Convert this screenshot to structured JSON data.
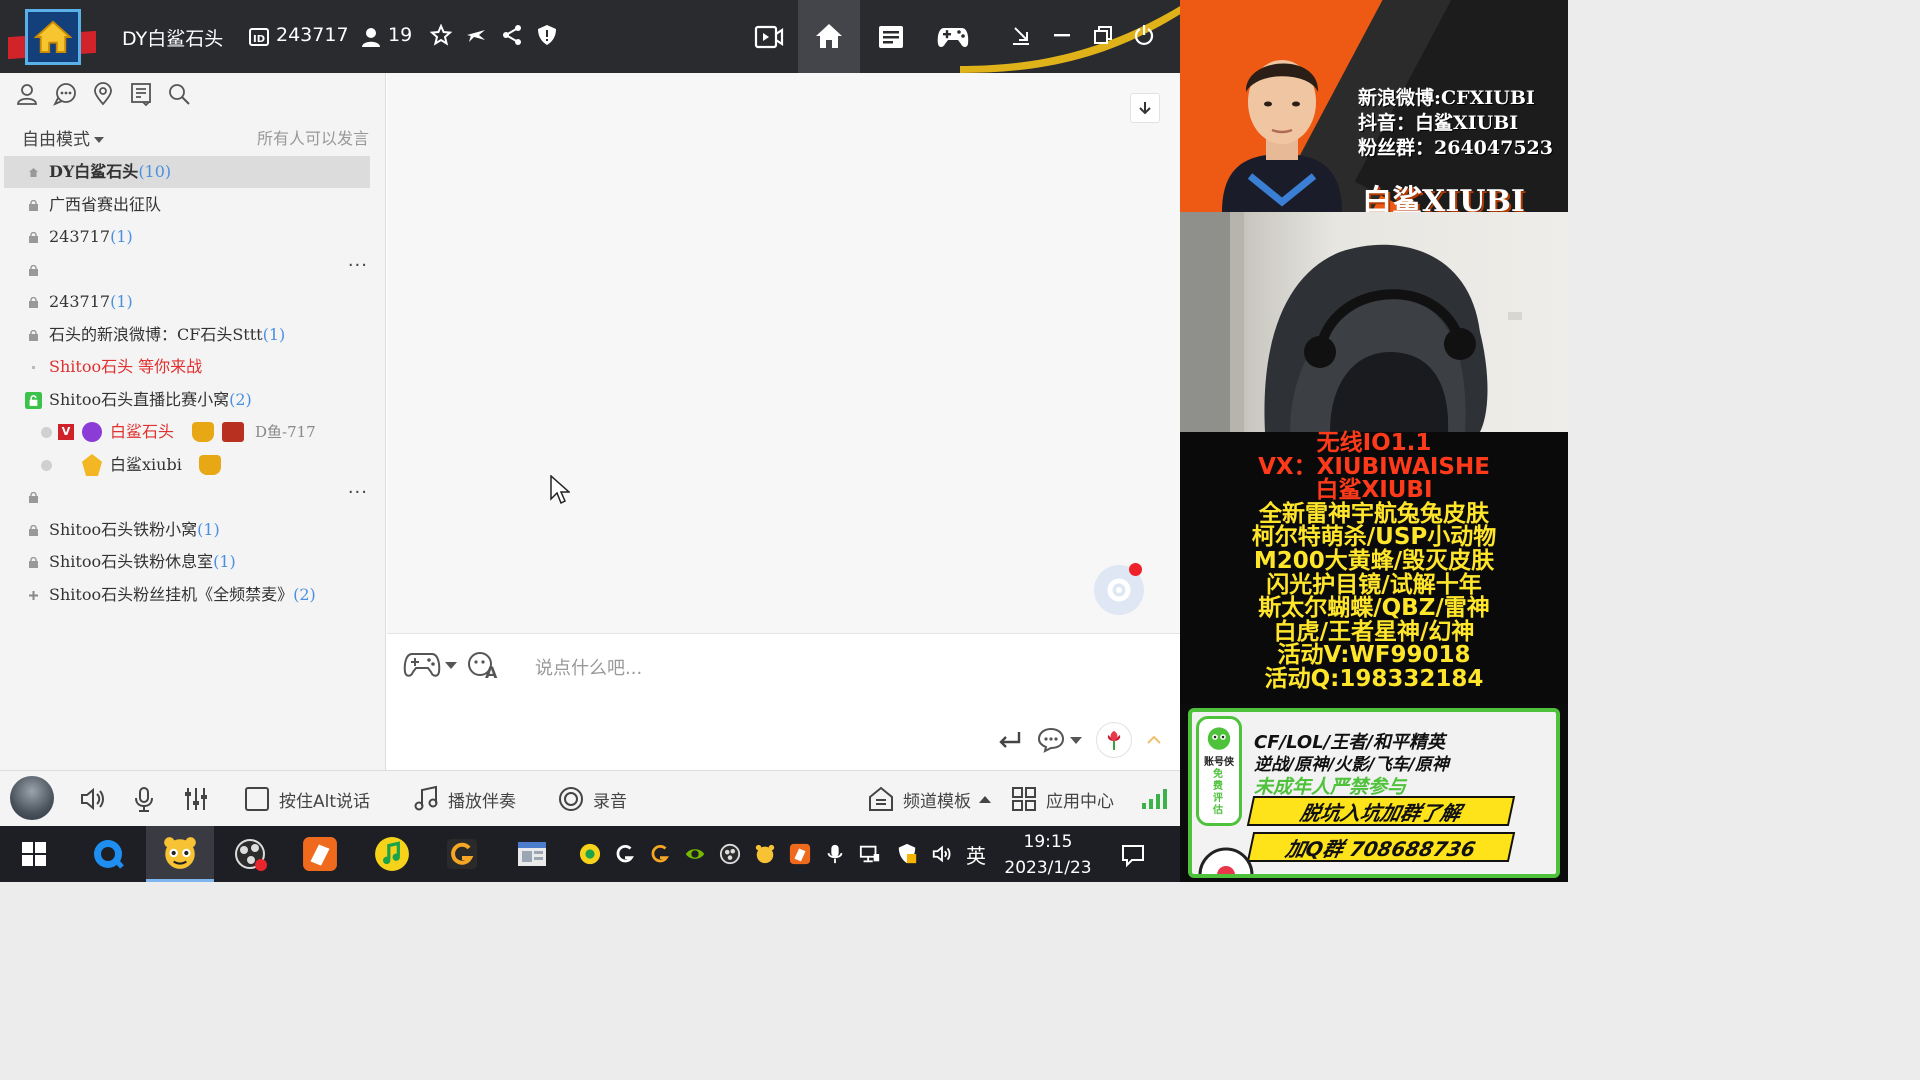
{
  "app": {
    "room_name": "DY白鲨石头",
    "room_id": "243717",
    "online_count": "19",
    "brand_color": "#2a2b2f",
    "accent_blue": "#4a90e2"
  },
  "sidebar": {
    "mode_label": "自由模式",
    "permission_text": "所有人可以发言",
    "channels": [
      {
        "name": "DY白鲨石头",
        "count": "(10)",
        "active": true
      },
      {
        "name": "广西省赛出征队",
        "count": ""
      },
      {
        "name": "243717",
        "count": "(1)"
      },
      {
        "name": "",
        "count": "",
        "more": "···"
      },
      {
        "name": "243717",
        "count": "(1)"
      },
      {
        "name": "石头的新浪微博：CF石头Sttt",
        "count": "(1)"
      },
      {
        "name": "Shitoo石头  等你来战",
        "count": "",
        "red": true
      },
      {
        "name": "Shitoo石头直播比赛小窝",
        "count": "(2)"
      },
      {
        "name": "",
        "count": "",
        "more": "···"
      },
      {
        "name": "Shitoo石头铁粉小窝",
        "count": "(1)"
      },
      {
        "name": "Shitoo石头铁粉休息室",
        "count": "(1)"
      },
      {
        "name": "Shitoo石头粉丝挂机《全频禁麦》",
        "count": "(2)"
      }
    ],
    "members": [
      {
        "name": "白鲨石头",
        "badge": "V",
        "tag": "D鱼-717"
      },
      {
        "name": "白鲨xiubi"
      }
    ]
  },
  "chat": {
    "input_placeholder": "说点什么吧..."
  },
  "bottombar": {
    "ptt_label": "按住Alt说话",
    "music_label": "播放伴奏",
    "record_label": "录音",
    "template_label": "频道模板",
    "appcenter_label": "应用中心"
  },
  "taskbar": {
    "ime": "英",
    "time": "19:15",
    "date": "2023/1/23"
  },
  "stream": {
    "weibo": "新浪微博:CFXIUBI",
    "douyin": "抖音：白鲨XIUBI",
    "fans_group": "粉丝群：264047523",
    "streamer_name": "白鲨XIUBI",
    "promo_lines": [
      "无线IO1.1",
      "VX：XIUBIWAISHE",
      "白鲨XIUBI",
      "全新雷神宇航兔兔皮肤",
      "柯尔特萌杀/USP小动物",
      "M200大黄蜂/毁灭皮肤",
      "闪光护目镜/试解十年",
      "斯太尔蝴蝶/QBZ/雷神",
      "白虎/王者星神/幻神",
      "活动V:WF99018",
      "活动Q:198332184"
    ],
    "card": {
      "games1": "CF/LOL/王者/和平精英",
      "games2": "逆战/原神/火影/飞车/原神",
      "warning": "未成年人严禁参与",
      "button": "脱坑入坑加群了解",
      "qq": "加Q群 708688736",
      "mascot_title": "账号侠",
      "mascot_sub": "免费评估"
    }
  }
}
